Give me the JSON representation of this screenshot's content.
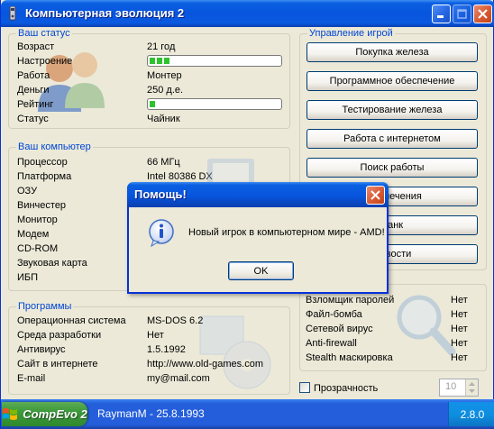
{
  "window": {
    "title": "Компьютерная эволюция 2"
  },
  "status": {
    "legend": "Ваш статус",
    "rows": [
      {
        "label": "Возраст",
        "value": "21 год"
      },
      {
        "label": "Настроение",
        "progress": 0.1
      },
      {
        "label": "Работа",
        "value": "Монтер"
      },
      {
        "label": "Деньги",
        "value": "250 д.е."
      },
      {
        "label": "Рейтинг",
        "progress": 0.02
      },
      {
        "label": "Статус",
        "value": "Чайник"
      }
    ]
  },
  "computer": {
    "legend": "Ваш компьютер",
    "rows": [
      {
        "label": "Процессор",
        "value": "66 МГц"
      },
      {
        "label": "Платформа",
        "value": "Intel 80386 DX"
      },
      {
        "label": "ОЗУ",
        "value": ""
      },
      {
        "label": "Винчестер",
        "value": ""
      },
      {
        "label": "Монитор",
        "value": ""
      },
      {
        "label": "Модем",
        "value": ""
      },
      {
        "label": "CD-ROM",
        "value": ""
      },
      {
        "label": "Звуковая карта",
        "value": ""
      },
      {
        "label": "ИБП",
        "value": ""
      }
    ]
  },
  "programs": {
    "legend": "Программы",
    "rows": [
      {
        "label": "Операционная система",
        "value": "MS-DOS 6.2"
      },
      {
        "label": "Среда разработки",
        "value": "Нет"
      },
      {
        "label": "Антивирус",
        "value": "1.5.1992"
      },
      {
        "label": "Сайт в интернете",
        "value": "http://www.old-games.com"
      },
      {
        "label": "E-mail",
        "value": "my@mail.com"
      }
    ]
  },
  "control": {
    "legend": "Управление игрой",
    "buttons": [
      "Покупка железа",
      "Программное обеспечение",
      "Тестирование железа",
      "Работа с интернетом",
      "Поиск работы",
      "Развлечения",
      "Банк",
      "Новости"
    ]
  },
  "hacker": {
    "rows": [
      {
        "label": "Взломщик паролей",
        "value": "Нет"
      },
      {
        "label": "Файл-бомба",
        "value": "Нет"
      },
      {
        "label": "Сетевой вирус",
        "value": "Нет"
      },
      {
        "label": "Anti-firewall",
        "value": "Нет"
      },
      {
        "label": "Stealth маскировка",
        "value": "Нет"
      }
    ]
  },
  "transparency": {
    "label": "Прозрачность",
    "checked": false,
    "value": "10"
  },
  "taskbar": {
    "start_label": "CompEvo 2",
    "task": "RaymanM - 25.8.1993",
    "version": "2.8.0"
  },
  "dialog": {
    "title": "Помощь!",
    "message": "Новый игрок в компьютерном мире - AMD!",
    "ok_label": "OK"
  }
}
